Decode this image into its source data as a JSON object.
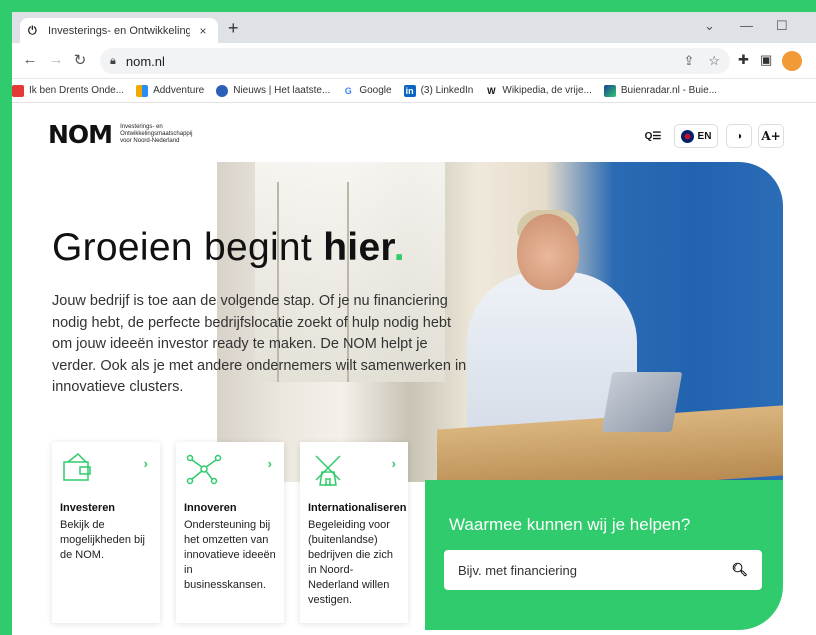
{
  "browser": {
    "tab_title": "Investerings- en Ontwikkelingsm",
    "tab_close": "×",
    "new_tab": "+",
    "url": "nom.nl",
    "window_min": "—",
    "window_max": "☐",
    "window_chevron": "⌄"
  },
  "bookmarks": [
    {
      "label": "Ik ben Drents Onde...",
      "color": "#e53935"
    },
    {
      "label": "Addventure",
      "color": "#f2a900"
    },
    {
      "label": "Nieuws | Het laatste...",
      "color": "#2b5fb8"
    },
    {
      "label": "Google",
      "color": "#4285f4"
    },
    {
      "label": "(3) LinkedIn",
      "color": "#0a66c2"
    },
    {
      "label": "Wikipedia, de vrije...",
      "color": "#ffffff"
    },
    {
      "label": "Buienradar.nl - Buie...",
      "color": "#1c3f94"
    }
  ],
  "header": {
    "logo_mark": "NOM",
    "logo_line1": "Investerings- en",
    "logo_line2": "Ontwikkelingsmaatschappij",
    "logo_line3": "voor Noord-Nederland",
    "lang_label": "EN",
    "font_size_label": "A+"
  },
  "hero": {
    "title_part1": "Groeien begint ",
    "title_bold": "hier",
    "title_dot": ".",
    "lead": "Jouw bedrijf is toe aan de volgende stap. Of je nu financiering nodig hebt, de perfecte bedrijfslocatie zoekt of hulp nodig hebt om jouw ideeën investor ready te maken. De NOM helpt je verder. Ook als je met andere ondernemers wilt samenwerken in innovatieve clusters."
  },
  "cards": [
    {
      "title": "Investeren",
      "desc": "Bekijk de mogelijkheden bij de NOM.",
      "icon": "wallet-icon"
    },
    {
      "title": "Innoveren",
      "desc": "Ondersteuning bij het omzetten van innovatieve ideeën in businesskansen.",
      "icon": "network-icon"
    },
    {
      "title": "Internationaliseren",
      "desc": "Begeleiding voor (buitenlandse) bedrijven die zich in Noord-Nederland willen vestigen.",
      "icon": "windmill-icon"
    }
  ],
  "help": {
    "question": "Waarmee kunnen wij je helpen?",
    "placeholder": "Bijv. met financiering"
  },
  "colors": {
    "brand_green": "#2fcb6c"
  }
}
